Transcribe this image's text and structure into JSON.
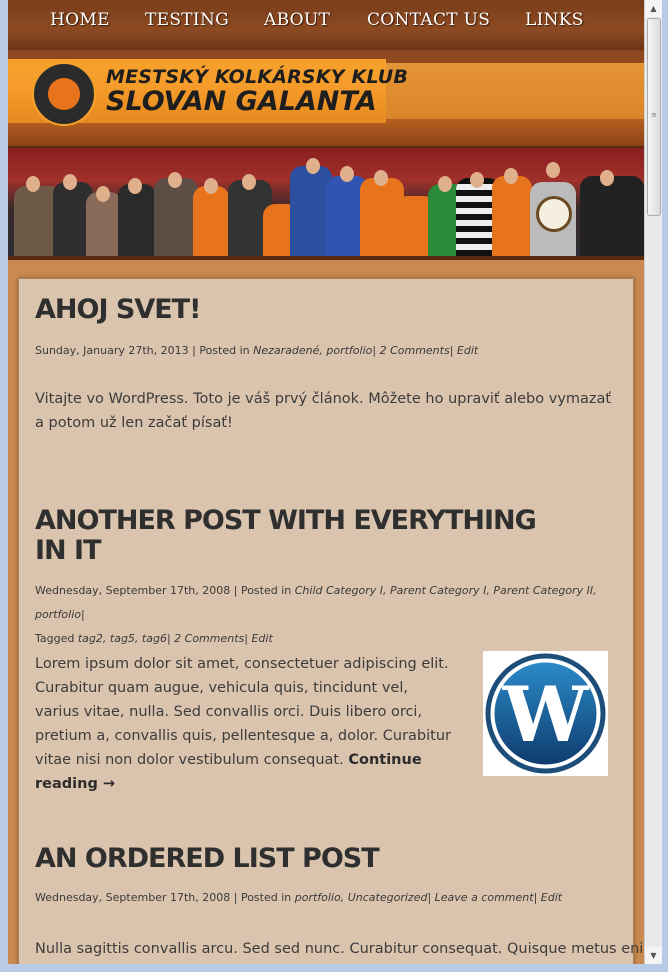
{
  "nav": {
    "items": [
      "HOME",
      "TESTING",
      "ABOUT",
      "CONTACT US",
      "LINKS"
    ]
  },
  "header": {
    "logo_text": "MKK SLOVAN GALANTA",
    "title_line1": "MESTSKÝ KOLKÁRSKY KLUB",
    "title_line2": "SLOVAN GALANTA"
  },
  "posts": [
    {
      "title": "AHOJ SVET!",
      "date": "Sunday, January 27th, 2013",
      "posted_in_label": "Posted in",
      "categories": "Nezaradené, portfolio",
      "comments": "2 Comments",
      "edit": "Edit",
      "excerpt": "Vitajte vo WordPress. Toto je váš prvý článok. Môžete ho upraviť alebo vymazať a potom už len začať písať!"
    },
    {
      "title": "ANOTHER POST WITH EVERYTHING IN IT",
      "date": "Wednesday, September 17th, 2008",
      "posted_in_label": "Posted in",
      "categories": "Child Category I, Parent Category I, Parent Category II, portfolio",
      "tagged_label": "Tagged",
      "tags": "tag2, tag5, tag6",
      "comments": "2 Comments",
      "edit": "Edit",
      "excerpt": "Lorem ipsum dolor sit amet, consectetuer adipiscing elit. Curabitur quam augue, vehicula quis, tincidunt vel, varius vitae, nulla. Sed convallis orci. Duis libero orci, pretium a, convallis quis, pellentesque a, dolor. Curabitur vitae nisi non dolor vestibulum consequat.",
      "continue": "Continue reading →"
    },
    {
      "title": "AN ORDERED LIST POST",
      "date": "Wednesday, September 17th, 2008",
      "posted_in_label": "Posted in",
      "categories": "portfolio, Uncategorized",
      "comments": "Leave a comment",
      "edit": "Edit",
      "excerpt": "Nulla sagittis convallis arcu. Sed sed nunc. Curabitur consequat. Quisque metus enim,"
    }
  ],
  "colors": {
    "nav_bg": "#7a3d1a",
    "banner_orange": "#f6a12c",
    "content_bg": "#dac4ad",
    "wordpress_blue": "#21759b"
  },
  "icons": {
    "wordpress": "wordpress-logo-icon",
    "scroll_up": "scroll-up-icon",
    "scroll_down": "scroll-down-icon"
  }
}
